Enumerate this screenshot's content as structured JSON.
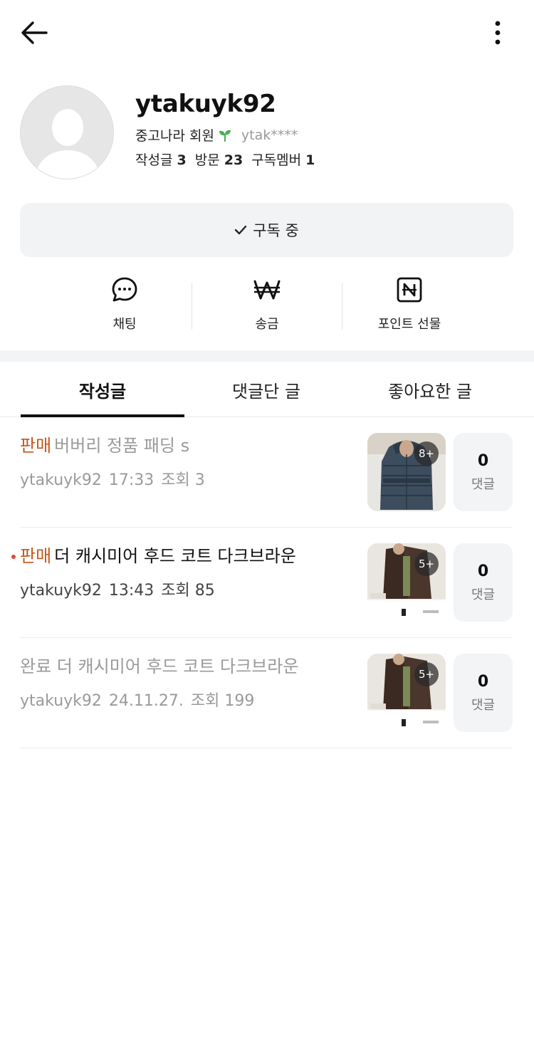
{
  "profile": {
    "nickname": "ytakuyk92",
    "grade": "중고나라 회원",
    "user_id": "ytak****",
    "stats": {
      "posts_label": "작성글",
      "posts_value": "3",
      "visits_label": "방문",
      "visits_value": "23",
      "subscribers_label": "구독멤버",
      "subscribers_value": "1"
    }
  },
  "subscribe": {
    "label": "구독 중"
  },
  "actions": {
    "chat": "채팅",
    "transfer": "송금",
    "point_gift": "포인트 선물"
  },
  "tabs": [
    {
      "label": "작성글",
      "active": true
    },
    {
      "label": "댓글단 글",
      "active": false
    },
    {
      "label": "좋아요한 글",
      "active": false
    }
  ],
  "posts": [
    {
      "tag": "판매",
      "title": "버버리 정품 패딩 s",
      "author": "ytakuyk92",
      "time": "17:33",
      "views": "조회 3",
      "photo_count": "8+",
      "comments": "0",
      "comments_label": "댓글",
      "state": "viewed"
    },
    {
      "tag": "판매",
      "title": "더 캐시미어 후드 코트 다크브라운",
      "author": "ytakuyk92",
      "time": "13:43",
      "views": "조회 85",
      "photo_count": "5+",
      "comments": "0",
      "comments_label": "댓글",
      "state": "new"
    },
    {
      "tag": "",
      "title": "완료 더 캐시미어 후드 코트 다크브라운",
      "author": "ytakuyk92",
      "time": "24.11.27.",
      "views": "조회 199",
      "photo_count": "5+",
      "comments": "0",
      "comments_label": "댓글",
      "state": "completed"
    }
  ],
  "colors": {
    "sale_tag": "#c4561a",
    "new_dot": "#e2473a",
    "sprout": "#4caf50",
    "surface": "#f2f3f5"
  }
}
